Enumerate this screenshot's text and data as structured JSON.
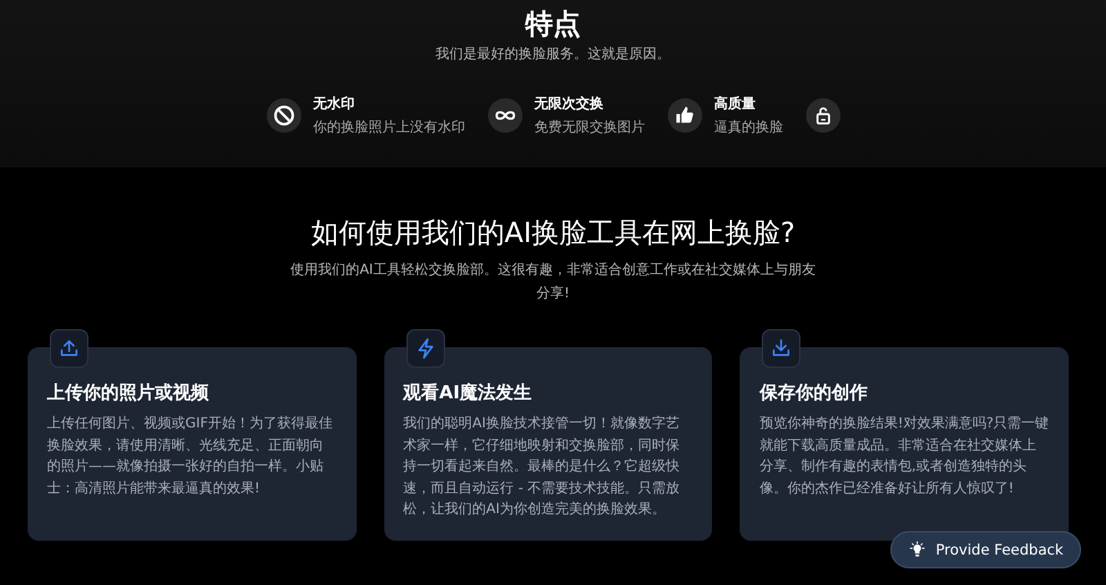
{
  "features_section": {
    "title": "特点",
    "subtitle": "我们是最好的换脸服务。这就是原因。",
    "features": [
      {
        "kind": "labeled",
        "title": "无水印",
        "description": "你的换脸照片上没有水印"
      },
      {
        "kind": "labeled",
        "title": "无限次交换",
        "description": "免费无限交换图片"
      },
      {
        "kind": "labeled",
        "title": "高质量",
        "description": "逼真的换脸"
      },
      {
        "kind": "icon_only"
      }
    ]
  },
  "how_to_section": {
    "title": "如何使用我们的AI换脸工具在网上换脸?",
    "subtitle": "使用我们的AI工具轻松交换脸部。这很有趣，非常适合创意工作或在社交媒体上与朋友分享!",
    "steps": [
      {
        "title": "上传你的照片或视频",
        "body": "上传任何图片、视频或GIF开始！为了获得最佳换脸效果，请使用清晰、光线充足、正面朝向的照片——就像拍摄一张好的自拍一样。小贴士：高清照片能带来最逼真的效果!"
      },
      {
        "title": "观看AI魔法发生",
        "body": "我们的聪明AI换脸技术接管一切！就像数字艺术家一样，它仔细地映射和交换脸部，同时保持一切看起来自然。最棒的是什么？它超级快速，而且自动运行 - 不需要技术技能。只需放松，让我们的AI为你创造完美的换脸效果。"
      },
      {
        "title": "保存你的创作",
        "body": "预览你神奇的换脸结果!对效果满意吗?只需一键就能下载高质量成品。非常适合在社交媒体上分享、制作有趣的表情包,或者创造独特的头像。你的杰作已经准备好让所有人惊叹了!"
      }
    ]
  },
  "feedback_button": {
    "label": "Provide Feedback"
  }
}
